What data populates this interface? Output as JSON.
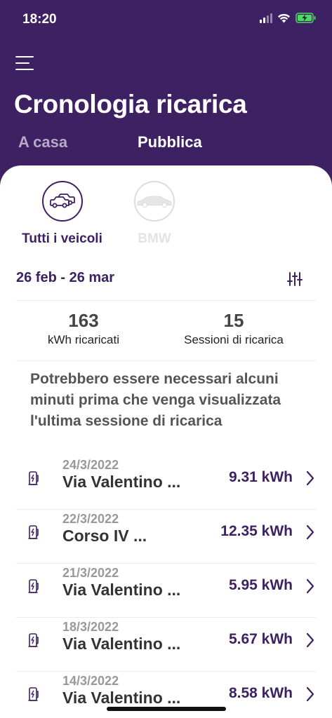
{
  "status_bar": {
    "time": "18:20"
  },
  "header": {
    "title": "Cronologia ricarica",
    "tabs": [
      {
        "label": "A casa",
        "active": false
      },
      {
        "label": "Pubblica",
        "active": true
      }
    ]
  },
  "vehicles": [
    {
      "label": "Tutti i veicoli",
      "selected": true,
      "icon": "two-cars-icon"
    },
    {
      "label": "BMW",
      "selected": false,
      "icon": "car-icon"
    }
  ],
  "date_range": "26 feb - 26 mar",
  "stats": {
    "kwh_value": "163",
    "kwh_label": "kWh ricaricati",
    "sessions_value": "15",
    "sessions_label": "Sessioni di ricarica"
  },
  "notice": "Potrebbero essere necessari alcuni minuti prima che venga visualizzata l'ultima sessione di ricarica",
  "sessions": [
    {
      "date": "24/3/2022",
      "address": "Via Valentino ...",
      "kwh": "9.31 kWh"
    },
    {
      "date": "22/3/2022",
      "address": "Corso IV ...",
      "kwh": "12.35 kWh"
    },
    {
      "date": "21/3/2022",
      "address": "Via Valentino ...",
      "kwh": "5.95 kWh"
    },
    {
      "date": "18/3/2022",
      "address": "Via Valentino ...",
      "kwh": "5.67 kWh"
    },
    {
      "date": "14/3/2022",
      "address": "Via Valentino ...",
      "kwh": "8.58 kWh"
    }
  ],
  "colors": {
    "brand": "#3e2162",
    "background": "#ffffff",
    "muted": "#999999"
  }
}
